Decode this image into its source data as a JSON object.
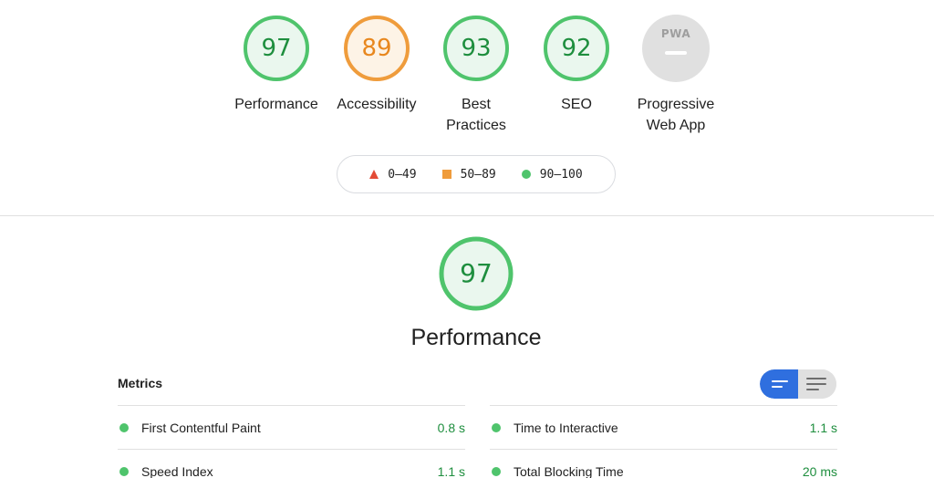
{
  "categories": [
    {
      "id": "performance",
      "score": "97",
      "label": "Performance",
      "status": "pass",
      "color": "#4fc46c",
      "text_color": "#1e8e3e",
      "fill": "#eaf7ee"
    },
    {
      "id": "accessibility",
      "score": "89",
      "label": "Accessibility",
      "status": "average",
      "color": "#ef9c3c",
      "text_color": "#e8871e",
      "fill": "#fdf3e6"
    },
    {
      "id": "best-practices",
      "score": "93",
      "label": "Best Practices",
      "status": "pass",
      "color": "#4fc46c",
      "text_color": "#1e8e3e",
      "fill": "#eaf7ee"
    },
    {
      "id": "seo",
      "score": "92",
      "label": "SEO",
      "status": "pass",
      "color": "#4fc46c",
      "text_color": "#1e8e3e",
      "fill": "#eaf7ee"
    },
    {
      "id": "pwa",
      "badge_text": "PWA",
      "label": "Progressive Web App",
      "status": "na",
      "color": "#e0e0e0"
    }
  ],
  "legend": {
    "fail": "0–49",
    "average": "50–89",
    "pass": "90–100"
  },
  "performance_section": {
    "score": "97",
    "title": "Performance"
  },
  "metrics": {
    "header": "Metrics",
    "view_toggle": {
      "active": "compact"
    },
    "left": [
      {
        "name": "First Contentful Paint",
        "value": "0.8 s"
      },
      {
        "name": "Speed Index",
        "value": "1.1 s"
      }
    ],
    "right": [
      {
        "name": "Time to Interactive",
        "value": "1.1 s"
      },
      {
        "name": "Total Blocking Time",
        "value": "20 ms"
      }
    ]
  }
}
